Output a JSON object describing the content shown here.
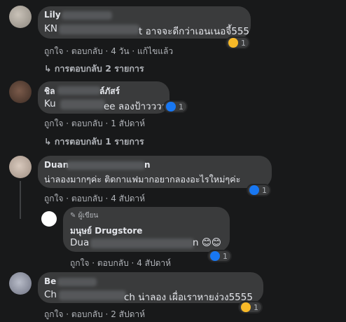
{
  "comments": [
    {
      "name": "Lily",
      "text_prefix": "KN",
      "text_suffix": "t อาจจะดีกว่าเอนเนอจี้555",
      "actions": {
        "like": "ถูกใจ",
        "reply": "ตอบกลับ",
        "time": "4 วัน",
        "edited": "แก้ไขแล้ว"
      },
      "reaction": {
        "type": "wow",
        "count": "1"
      },
      "replies_label": "การตอบกลับ 2 รายการ"
    },
    {
      "name_prefix": "ชิล",
      "name_suffix": "ล์ภัสร์",
      "text_prefix": "Ku",
      "text_suffix": "ee ลองป้าววววว",
      "actions": {
        "like": "ถูกใจ",
        "reply": "ตอบกลับ",
        "time": "1 สัปดาห์"
      },
      "reaction": {
        "type": "like",
        "count": "1"
      },
      "replies_label": "การตอบกลับ 1 รายการ"
    },
    {
      "name_prefix": "Duan",
      "name_suffix": "n",
      "text": "น่าลองมากๆค่ะ ติดกาแฟมากอยากลองอะไรใหม่ๆค่ะ",
      "actions": {
        "like": "ถูกใจ",
        "reply": "ตอบกลับ",
        "time": "4 สัปดาห์"
      },
      "reaction": {
        "type": "like",
        "count": "1"
      }
    },
    {
      "badge": "ผู้เขียน",
      "name": "มนุษย์ Drugstore",
      "text_prefix": "Dua",
      "text_suffix": "n 😊😊",
      "actions": {
        "like": "ถูกใจ",
        "reply": "ตอบกลับ",
        "time": "4 สัปดาห์"
      },
      "reaction": {
        "type": "like",
        "count": "1"
      }
    },
    {
      "name_prefix": "Be",
      "text_prefix": "Ch",
      "text_suffix": "ch น่าลอง เผื่อเราหายง่วง5555",
      "actions": {
        "like": "ถูกใจ",
        "reply": "ตอบกลับ",
        "time": "2 สัปดาห์"
      },
      "reaction": {
        "type": "haha",
        "count": "1"
      }
    }
  ],
  "separator": " · ",
  "reply_arrow": "↳",
  "colors": {
    "background": "#18191a",
    "bubble": "#3a3b3c",
    "like": "#1877f2",
    "haha": "#f7b928"
  }
}
